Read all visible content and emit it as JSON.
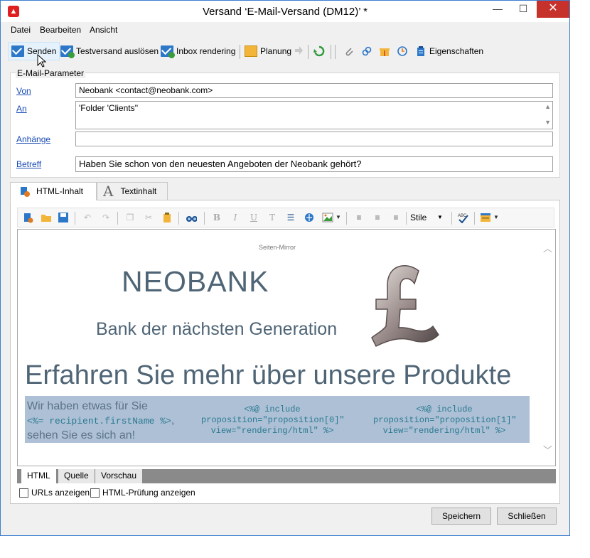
{
  "window": {
    "title": "Versand ‘E-Mail-Versand (DM12)’ *",
    "app_icon": "adobe-icon",
    "min_glyph": "—",
    "max_glyph": "☐",
    "close_glyph": "✕"
  },
  "menu": [
    "Datei",
    "Bearbeiten",
    "Ansicht"
  ],
  "toolbar": {
    "send": "Senden",
    "test": "Testversand auslösen",
    "inbox": "Inbox rendering",
    "schedule": "Planung",
    "properties": "Eigenschaften"
  },
  "params": {
    "legend": "E-Mail-Parameter",
    "from_label": "Von",
    "from_value": "Neobank <contact@neobank.com>",
    "to_label": "An",
    "to_value": "'Folder 'Clients''",
    "attach_label": "Anhänge",
    "attach_value": "",
    "subject_label": "Betreff",
    "subject_value": "Haben Sie schon von den neuesten Angeboten der Neobank gehört?"
  },
  "tabs": {
    "html": "HTML-Inhalt",
    "text": "Textinhalt"
  },
  "editor": {
    "style_label": "Stile"
  },
  "preview": {
    "mirror": "Seiten-Mirror",
    "brand": "NEOBANK",
    "tagline": "Bank der nächsten Generation",
    "headline": "Erfahren Sie mehr über unsere Produkte",
    "offer_line1": "Wir haben etwas für Sie",
    "offer_code": "<%= recipient.firstName %>",
    "offer_comma": ",",
    "offer_line3": "sehen Sie es sich an!",
    "prop0": "<%@ include\nproposition=\"proposition[0]\"\nview=\"rendering/html\" %>",
    "prop1": "<%@ include\nproposition=\"proposition[1]\"\nview=\"rendering/html\" %>"
  },
  "modes": [
    "HTML",
    "Quelle",
    "Vorschau"
  ],
  "options": {
    "show_urls": "URLs anzeigen",
    "html_check": "HTML-Prüfung anzeigen"
  },
  "buttons": {
    "save": "Speichern",
    "close": "Schließen"
  }
}
